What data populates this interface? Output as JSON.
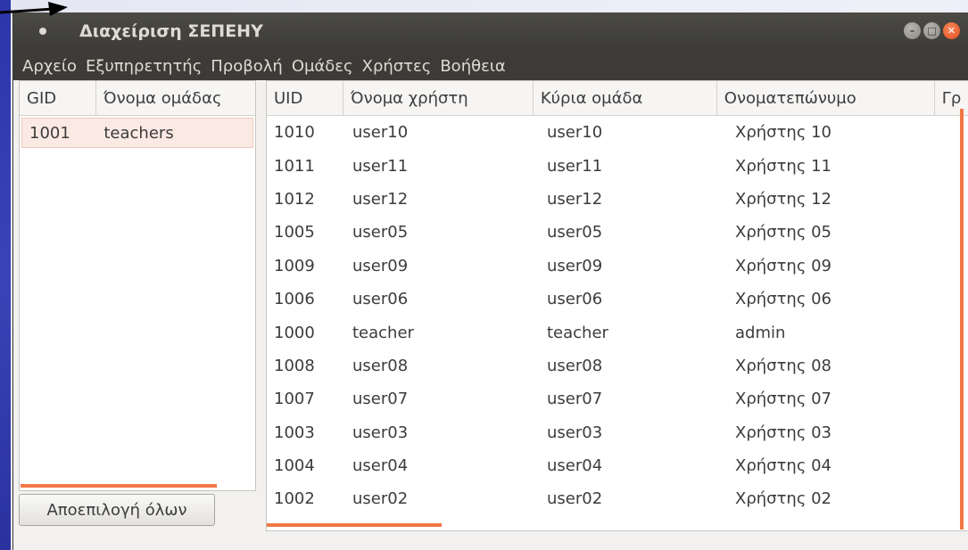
{
  "window": {
    "title": "Διαχείριση ΣΕΠΕΗΥ",
    "buttons": {
      "minimize": "–",
      "maximize": "□",
      "close": "✕"
    }
  },
  "menubar": {
    "items": [
      "Αρχείο",
      "Εξυπηρετητής",
      "Προβολή",
      "Ομάδες",
      "Χρήστες",
      "Βοήθεια"
    ]
  },
  "groups": {
    "columns": [
      "GID",
      "Όνομα ομάδας"
    ],
    "rows": [
      {
        "gid": "1001",
        "name": "teachers",
        "selected": true
      }
    ]
  },
  "users": {
    "columns": [
      "UID",
      "Όνομα χρήστη",
      "Κύρια ομάδα",
      "Ονοματεπώνυμο",
      "Γρ"
    ],
    "rows": [
      {
        "uid": "1010",
        "username": "user10",
        "group": "user10",
        "fullname": "Χρήστης 10"
      },
      {
        "uid": "1011",
        "username": "user11",
        "group": "user11",
        "fullname": "Χρήστης 11"
      },
      {
        "uid": "1012",
        "username": "user12",
        "group": "user12",
        "fullname": "Χρήστης 12"
      },
      {
        "uid": "1005",
        "username": "user05",
        "group": "user05",
        "fullname": "Χρήστης 05"
      },
      {
        "uid": "1009",
        "username": "user09",
        "group": "user09",
        "fullname": "Χρήστης 09"
      },
      {
        "uid": "1006",
        "username": "user06",
        "group": "user06",
        "fullname": "Χρήστης 06"
      },
      {
        "uid": "1000",
        "username": "teacher",
        "group": "teacher",
        "fullname": "admin"
      },
      {
        "uid": "1008",
        "username": "user08",
        "group": "user08",
        "fullname": "Χρήστης 08"
      },
      {
        "uid": "1007",
        "username": "user07",
        "group": "user07",
        "fullname": "Χρήστης 07"
      },
      {
        "uid": "1003",
        "username": "user03",
        "group": "user03",
        "fullname": "Χρήστης 03"
      },
      {
        "uid": "1004",
        "username": "user04",
        "group": "user04",
        "fullname": "Χρήστης 04"
      },
      {
        "uid": "1002",
        "username": "user02",
        "group": "user02",
        "fullname": "Χρήστης 02"
      }
    ]
  },
  "actions": {
    "deselect_all": "Αποεπιλογή όλων"
  },
  "colors": {
    "titlebar": "#3c3b37",
    "accent_orange": "#f07746",
    "selection_bg": "#fbe9e3",
    "close_button": "#e0501e",
    "desktop_stripe": "#2c36a8"
  }
}
